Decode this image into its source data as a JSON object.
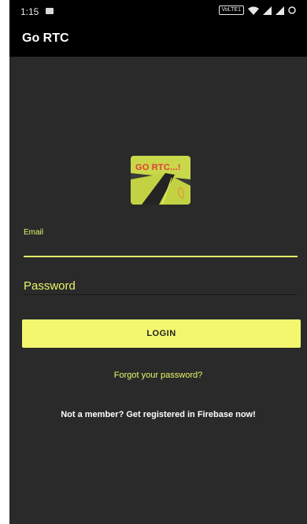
{
  "status_bar": {
    "time": "1:15",
    "network_badge": "VoLTE1",
    "icons": [
      "image-icon",
      "wifi-icon",
      "signal-icon",
      "signal-icon",
      "circle-icon"
    ]
  },
  "app_bar": {
    "title": "Go RTC"
  },
  "logo": {
    "text": "GO RTC...!"
  },
  "login_form": {
    "email_label": "Email",
    "email_value": "",
    "password_placeholder": "Password",
    "login_label": "LOGIN",
    "forgot_label": "Forgot your password?",
    "register_label": "Not a member? Get registered in Firebase now!"
  },
  "colors": {
    "background": "#2a2a2a",
    "bar": "#000000",
    "accent": "#e8f56a",
    "button": "#f2f76e",
    "logo_text": "#e23a3a"
  }
}
